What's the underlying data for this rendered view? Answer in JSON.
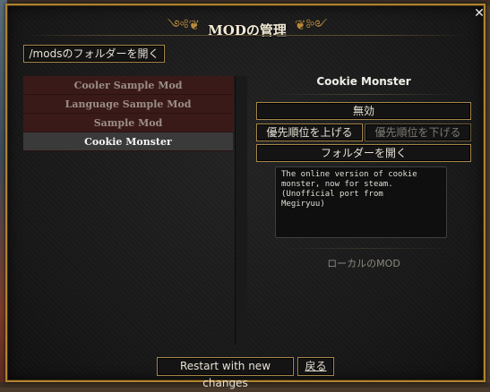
{
  "dialog": {
    "title": "MODの管理",
    "close_symbol": "✕",
    "ornament_left": "༺❦",
    "ornament_right": "❦༻"
  },
  "toolbar": {
    "open_mods_folder_label": "/modsのフォルダーを開く"
  },
  "mod_list": {
    "items": [
      {
        "label": "Cooler Sample Mod",
        "selected": false
      },
      {
        "label": "Language Sample Mod",
        "selected": false
      },
      {
        "label": "Sample Mod",
        "selected": false
      },
      {
        "label": "Cookie Monster",
        "selected": true
      }
    ]
  },
  "details": {
    "title": "Cookie Monster",
    "disable_label": "無効",
    "priority_up_label": "優先順位を上げる",
    "priority_down_label": "優先順位を下げる",
    "open_folder_label": "フォルダーを開く",
    "description": "The online version of cookie\nmonster, now for steam.\n(Unofficial port from\nMegiryuu)",
    "source_label": "ローカルのMOD"
  },
  "footer": {
    "restart_label": "Restart with new changes",
    "back_label": "戻る"
  },
  "colors": {
    "accent_gold": "#b0832f",
    "list_bg": "#3a1a19",
    "selected_bg": "#3a3a3a"
  },
  "icons": {
    "close": "close-icon",
    "ornament": "ornament-icon"
  }
}
